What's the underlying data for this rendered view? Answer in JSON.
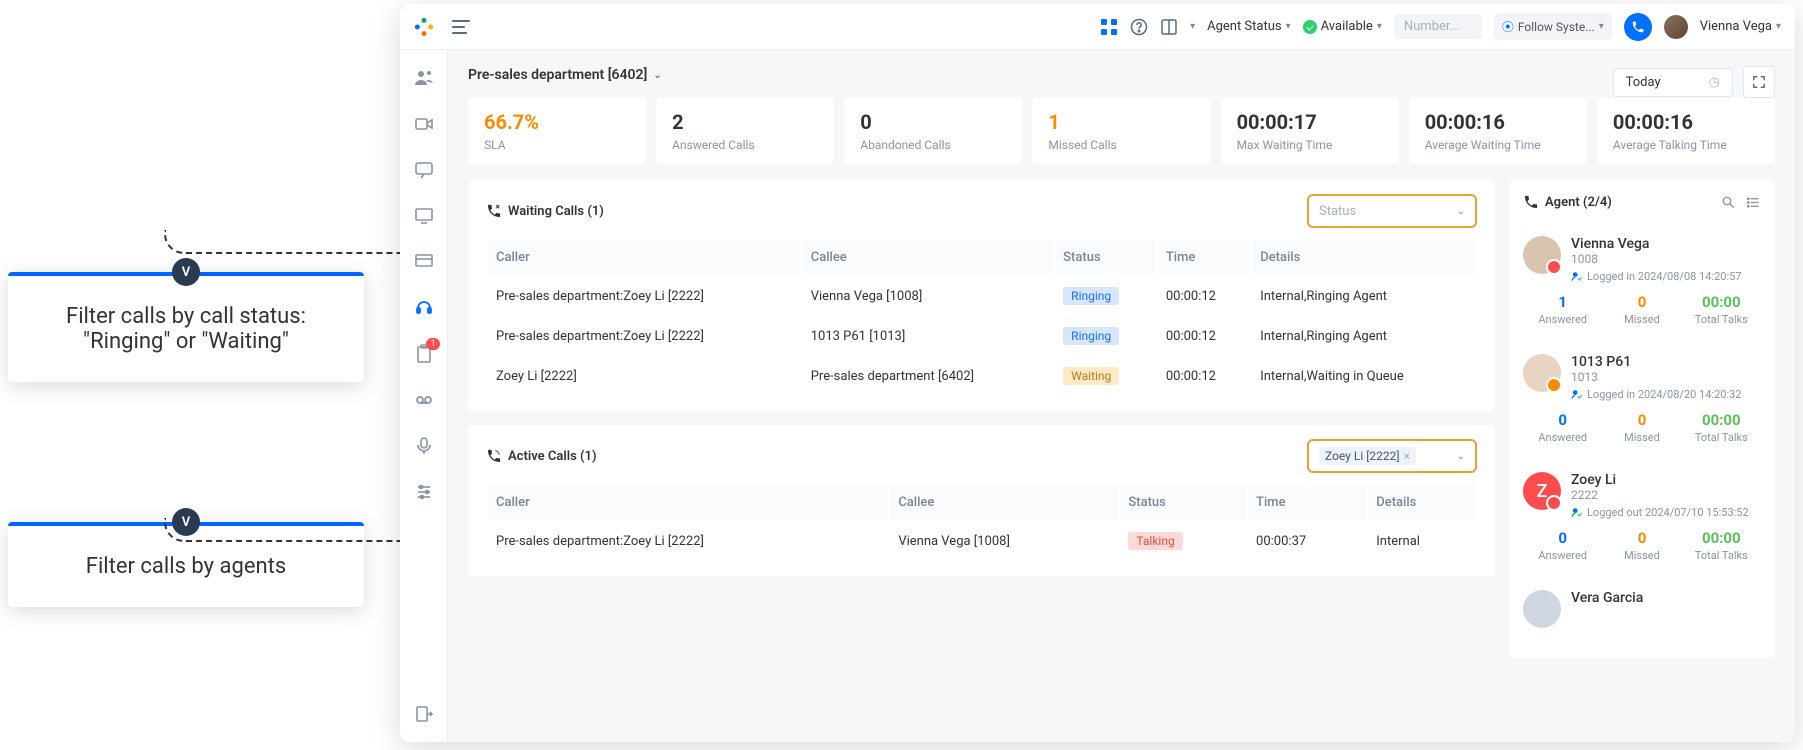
{
  "topbar": {
    "agent_status_label": "Agent Status",
    "available_label": "Available",
    "number_placeholder": "Number...",
    "follow_system_label": "Follow Syste...",
    "user_name": "Vienna Vega"
  },
  "callouts": {
    "status": "Filter calls by call status: \"Ringing\" or \"Waiting\"",
    "agents": "Filter calls by agents",
    "badge": "V"
  },
  "breadcrumb": {
    "dept": "Pre-sales department [6402]",
    "date": "Today"
  },
  "stats": [
    {
      "value": "66.7%",
      "label": "SLA",
      "orange": true
    },
    {
      "value": "2",
      "label": "Answered Calls"
    },
    {
      "value": "0",
      "label": "Abandoned Calls"
    },
    {
      "value": "1",
      "label": "Missed Calls",
      "orange": true
    },
    {
      "value": "00:00:17",
      "label": "Max Waiting Time"
    },
    {
      "value": "00:00:16",
      "label": "Average Waiting Time"
    },
    {
      "value": "00:00:16",
      "label": "Average Talking Time"
    }
  ],
  "waiting": {
    "title": "Waiting Calls (1)",
    "filter_placeholder": "Status",
    "headers": [
      "Caller",
      "Callee",
      "Status",
      "Time",
      "Details"
    ],
    "rows": [
      {
        "caller": "Pre-sales department:Zoey Li [2222]",
        "callee": "Vienna Vega [1008]",
        "status": "Ringing",
        "status_cls": "ringing",
        "time": "00:00:12",
        "details": "Internal,Ringing Agent"
      },
      {
        "caller": "Pre-sales department:Zoey Li [2222]",
        "callee": "1013 P61 [1013]",
        "status": "Ringing",
        "status_cls": "ringing",
        "time": "00:00:12",
        "details": "Internal,Ringing Agent"
      },
      {
        "caller": "Zoey Li [2222]",
        "callee": "Pre-sales department [6402]",
        "status": "Waiting",
        "status_cls": "waiting",
        "time": "00:00:12",
        "details": "Internal,Waiting in Queue"
      }
    ]
  },
  "active": {
    "title": "Active Calls (1)",
    "filter_chip": "Zoey Li [2222]",
    "headers": [
      "Caller",
      "Callee",
      "Status",
      "Time",
      "Details"
    ],
    "rows": [
      {
        "caller": "Pre-sales department:Zoey Li [2222]",
        "callee": "Vienna Vega [1008]",
        "status": "Talking",
        "status_cls": "talking",
        "time": "00:00:37",
        "details": "Internal"
      }
    ]
  },
  "agent_panel": {
    "title": "Agent (2/4)",
    "stat_labels": {
      "answered": "Answered",
      "missed": "Missed",
      "talks": "Total Talks"
    },
    "agents": [
      {
        "name": "Vienna Vega",
        "ext": "1008",
        "log": "Logged in 2024/08/08 14:20:57",
        "answered": "1",
        "missed": "0",
        "talks": "00:00",
        "ava_cls": "red-dot",
        "ava_bg": "#d9c4b0"
      },
      {
        "name": "1013 P61",
        "ext": "1013",
        "log": "Logged in 2024/08/20 14:20:32",
        "answered": "0",
        "missed": "0",
        "talks": "00:00",
        "ava_cls": "orange-dot",
        "ava_bg": "#e8d4c0"
      },
      {
        "name": "Zoey Li",
        "ext": "2222",
        "log": "Logged out 2024/07/10 15:53:52",
        "answered": "0",
        "missed": "0",
        "talks": "00:00",
        "ava_cls": "red-dot z",
        "letter": "Z"
      },
      {
        "name": "Vera Garcia",
        "ext": "",
        "log": "",
        "answered": "",
        "missed": "",
        "talks": ""
      }
    ]
  },
  "sidebar": {
    "badge": "1"
  }
}
